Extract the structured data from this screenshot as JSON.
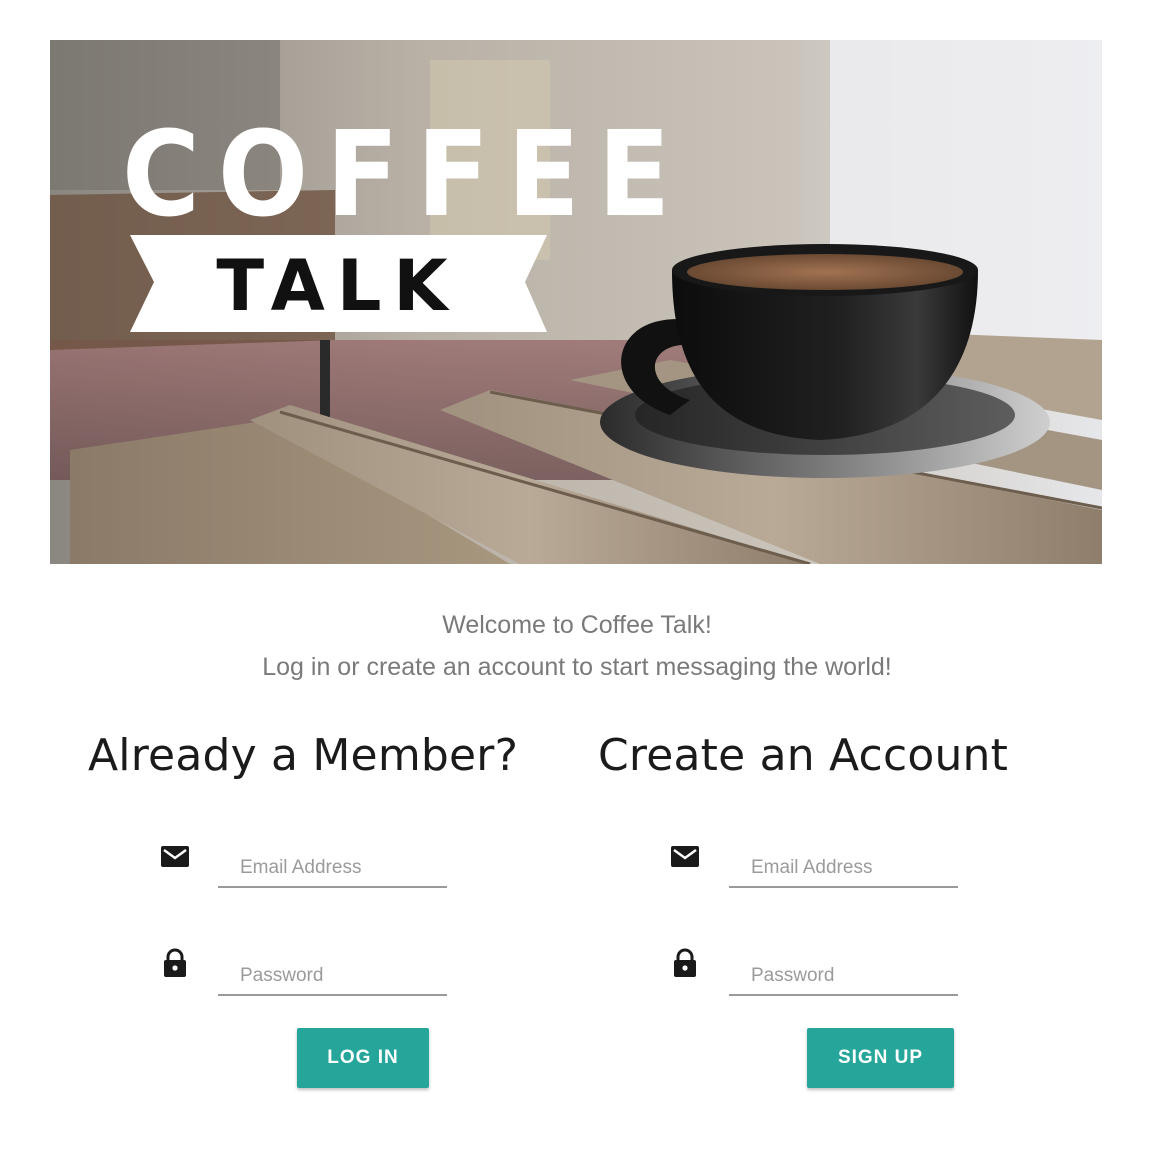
{
  "hero": {
    "logo_top": "COFFEE",
    "logo_bottom": "TALK"
  },
  "welcome": {
    "line1": "Welcome to Coffee Talk!",
    "line2": "Log in or create an account to start messaging the world!"
  },
  "login": {
    "heading": "Already a Member?",
    "email_placeholder": "Email Address",
    "password_placeholder": "Password",
    "button_label": "LOG IN",
    "email_icon": "envelope-icon",
    "password_icon": "lock-icon"
  },
  "signup": {
    "heading": "Create an Account",
    "email_placeholder": "Email Address",
    "password_placeholder": "Password",
    "button_label": "SIGN UP",
    "email_icon": "envelope-icon",
    "password_icon": "lock-icon"
  },
  "colors": {
    "accent": "#26a69a",
    "heading": "#1b1b1b",
    "muted_text": "#7a7a7a",
    "underline": "#9a9a9a"
  }
}
